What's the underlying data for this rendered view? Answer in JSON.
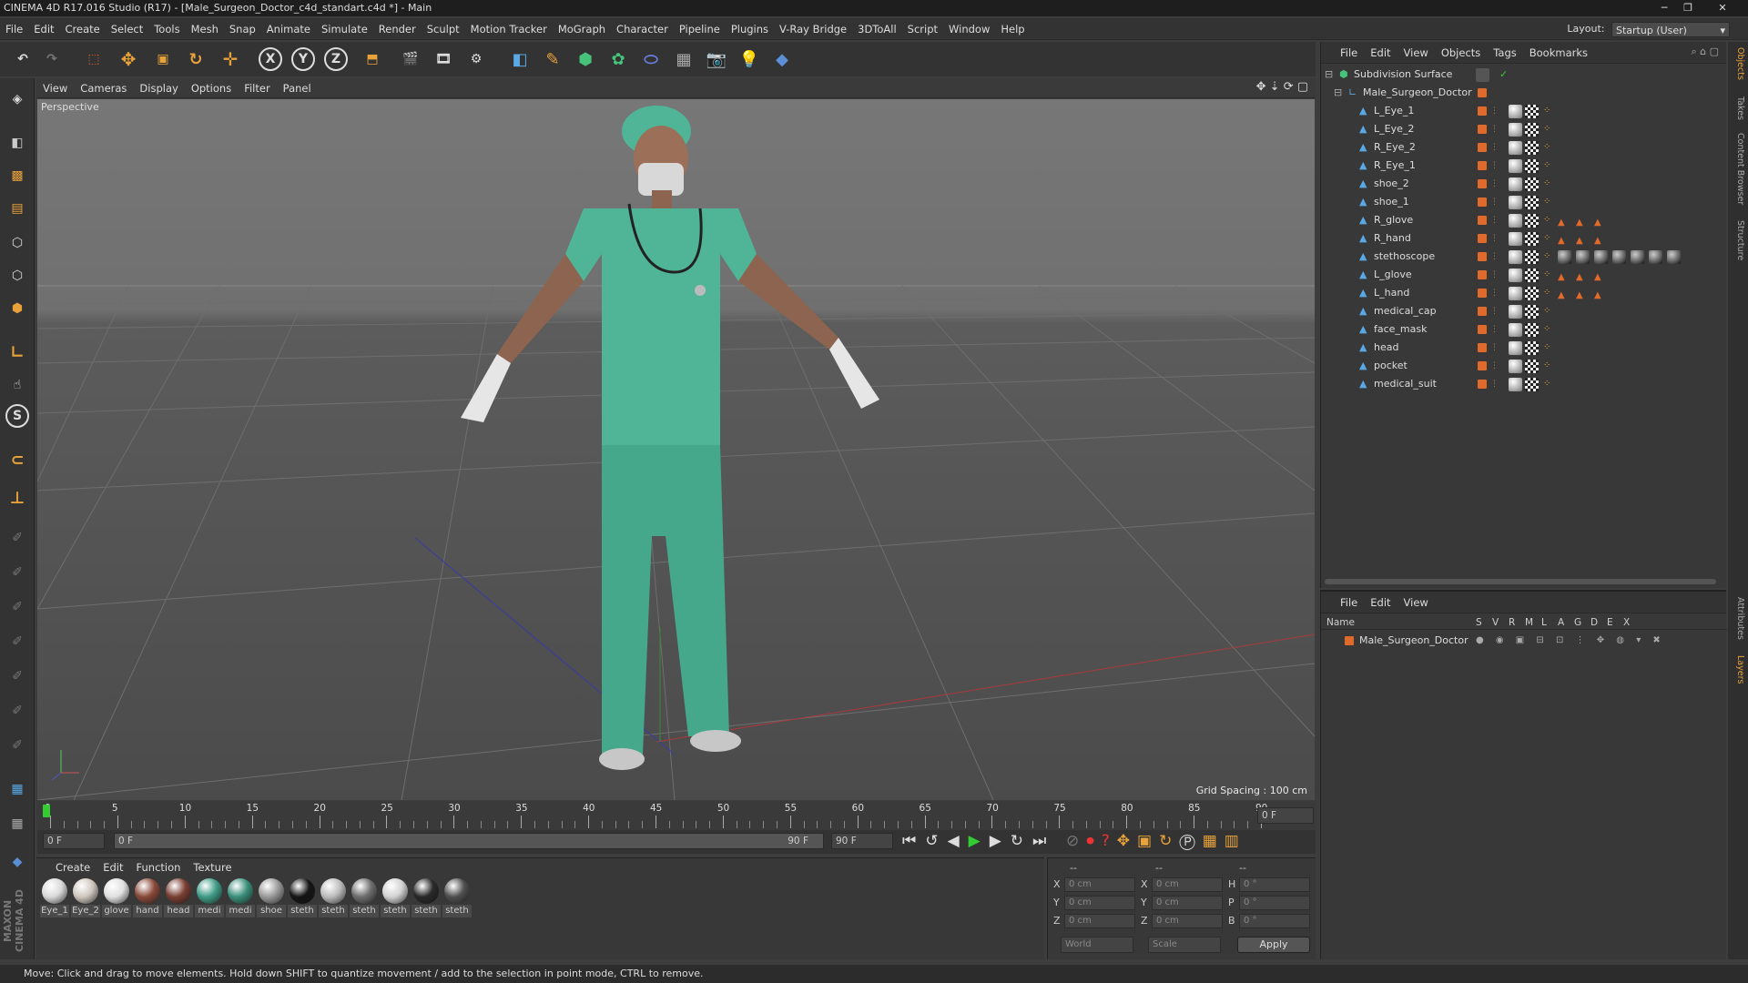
{
  "window": {
    "title": "CINEMA 4D R17.016 Studio (R17) - [Male_Surgeon_Doctor_c4d_standart.c4d *] - Main"
  },
  "menubar": [
    "File",
    "Edit",
    "Create",
    "Select",
    "Tools",
    "Mesh",
    "Snap",
    "Animate",
    "Simulate",
    "Render",
    "Sculpt",
    "Motion Tracker",
    "MoGraph",
    "Character",
    "Pipeline",
    "Plugins",
    "V-Ray Bridge",
    "3DToAll",
    "Script",
    "Window",
    "Help"
  ],
  "layout": {
    "label": "Layout:",
    "value": "Startup (User)"
  },
  "toolbar": {
    "axis_x": "X",
    "axis_y": "Y",
    "axis_z": "Z"
  },
  "viewport": {
    "menu": [
      "View",
      "Cameras",
      "Display",
      "Options",
      "Filter",
      "Panel"
    ],
    "label": "Perspective",
    "grid_spacing": "Grid Spacing : 100 cm"
  },
  "timeline": {
    "ticks": [
      "0",
      "5",
      "10",
      "15",
      "20",
      "25",
      "30",
      "35",
      "40",
      "45",
      "50",
      "55",
      "60",
      "65",
      "70",
      "75",
      "80",
      "85",
      "90"
    ],
    "end_field": "0 F",
    "current_frame": "0 F",
    "range_start": "0 F",
    "range_end": "90 F",
    "max_field": "90 F"
  },
  "materials": {
    "menu": [
      "Create",
      "Edit",
      "Function",
      "Texture"
    ],
    "items": [
      {
        "label": "Eye_1",
        "color": "#d9d9d9"
      },
      {
        "label": "Eye_2",
        "color": "#cfc7bf"
      },
      {
        "label": "glove",
        "color": "#e0e0e0"
      },
      {
        "label": "hand",
        "color": "#8a4a3a"
      },
      {
        "label": "head",
        "color": "#7a3f33"
      },
      {
        "label": "medi",
        "color": "#3f9c86"
      },
      {
        "label": "medi",
        "color": "#3a8f7b"
      },
      {
        "label": "shoe",
        "color": "#9a9a9a"
      },
      {
        "label": "steth",
        "color": "#151515"
      },
      {
        "label": "steth",
        "color": "#bcbcbc"
      },
      {
        "label": "steth",
        "color": "#6e6e6e"
      },
      {
        "label": "steth",
        "color": "#d2d2d2"
      },
      {
        "label": "steth",
        "color": "#2a2a2a"
      },
      {
        "label": "steth",
        "color": "#505050"
      }
    ]
  },
  "coords": {
    "header": [
      "--",
      "--",
      "--"
    ],
    "rows": [
      {
        "a": "X",
        "av": "0 cm",
        "b": "X",
        "bv": "0 cm",
        "c": "H",
        "cv": "0 °"
      },
      {
        "a": "Y",
        "av": "0 cm",
        "b": "Y",
        "bv": "0 cm",
        "c": "P",
        "cv": "0 °"
      },
      {
        "a": "Z",
        "av": "0 cm",
        "b": "Z",
        "bv": "0 cm",
        "c": "B",
        "cv": "0 °"
      }
    ],
    "world": "World",
    "scale": "Scale",
    "apply": "Apply"
  },
  "objects": {
    "menu": [
      "File",
      "Edit",
      "View",
      "Objects",
      "Tags",
      "Bookmarks"
    ],
    "root": "Subdivision Surface",
    "group": "Male_Surgeon_Doctor",
    "items": [
      "L_Eye_1",
      "L_Eye_2",
      "R_Eye_2",
      "R_Eye_1",
      "shoe_2",
      "shoe_1",
      "R_glove",
      "R_hand",
      "stethoscope",
      "L_glove",
      "L_hand",
      "medical_cap",
      "face_mask",
      "head",
      "pocket",
      "medical_suit"
    ]
  },
  "layers": {
    "menu": [
      "File",
      "Edit",
      "View"
    ],
    "columns": [
      "Name",
      "S",
      "V",
      "R",
      "M",
      "L",
      "A",
      "G",
      "D",
      "E",
      "X"
    ],
    "row": "Male_Surgeon_Doctor"
  },
  "side_tabs": [
    "Objects",
    "Takes",
    "Content Browser",
    "Structure",
    "Attributes",
    "Layers"
  ],
  "status": "Move: Click and drag to move elements. Hold down SHIFT to quantize movement / add to the selection in point mode, CTRL to remove.",
  "brand": "MAXON CINEMA 4D"
}
